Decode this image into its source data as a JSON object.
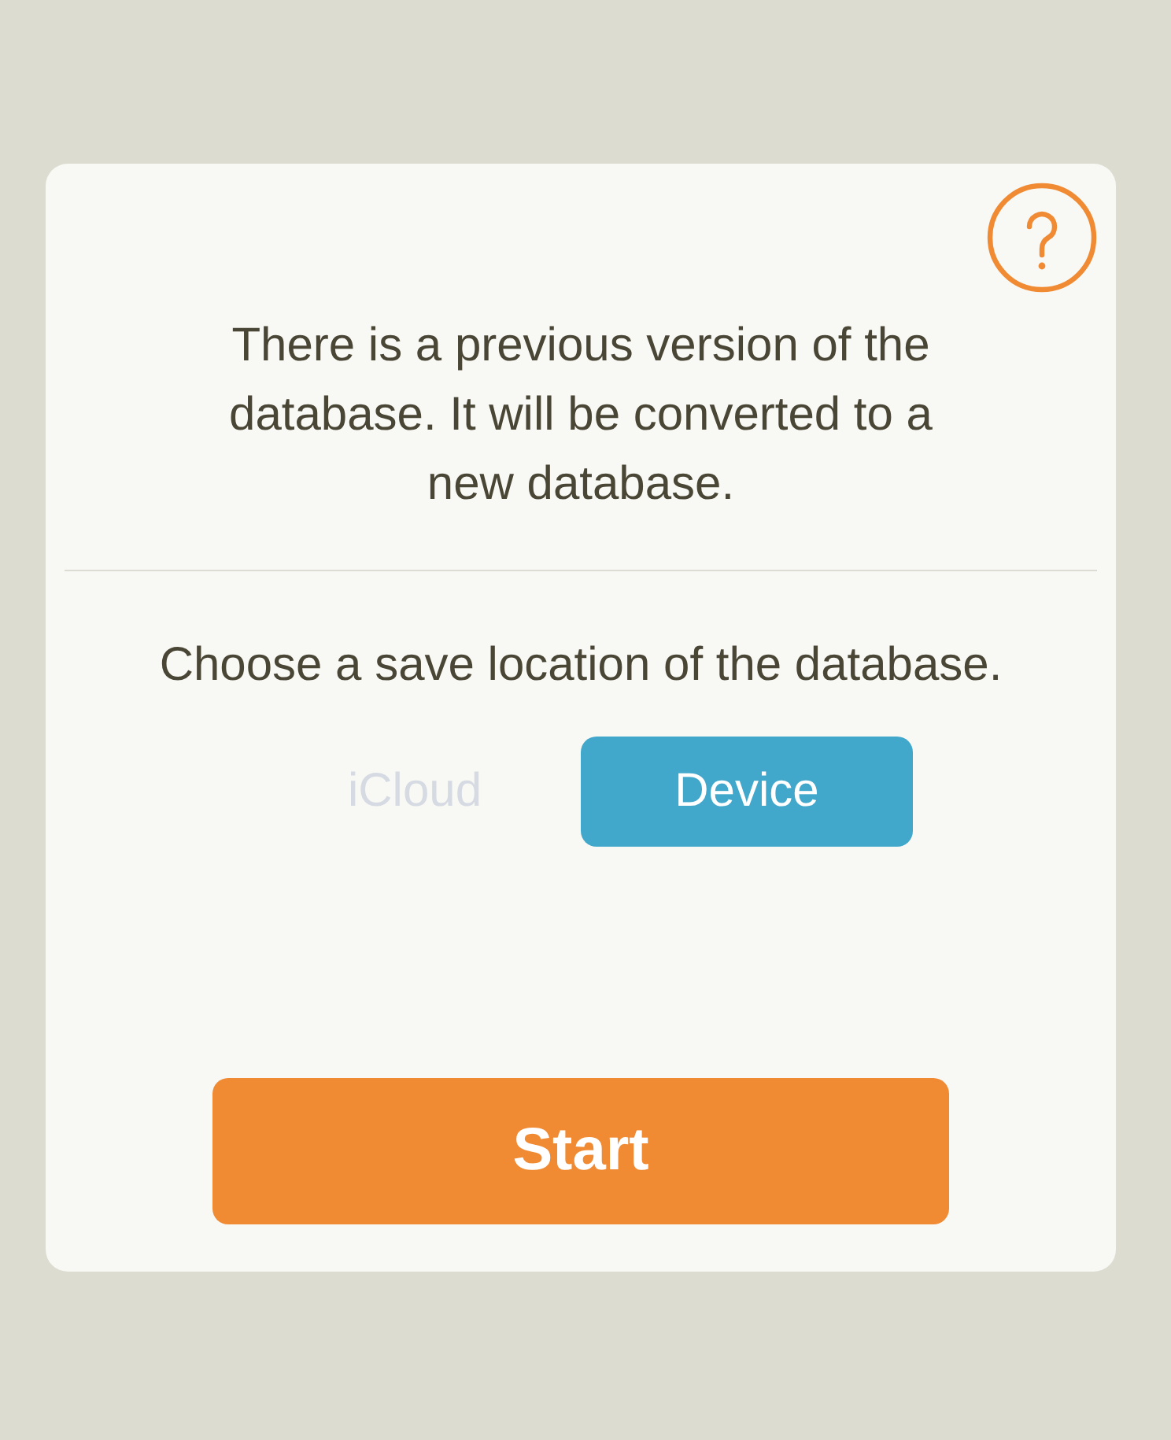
{
  "dialog": {
    "message": "There is a previous version of the database. It will be converted to a new database.",
    "prompt": "Choose a save location of the database.",
    "locations": [
      {
        "label": "iCloud",
        "selected": false,
        "disabled": true
      },
      {
        "label": "Device",
        "selected": true,
        "disabled": false
      }
    ],
    "start_button": "Start"
  }
}
